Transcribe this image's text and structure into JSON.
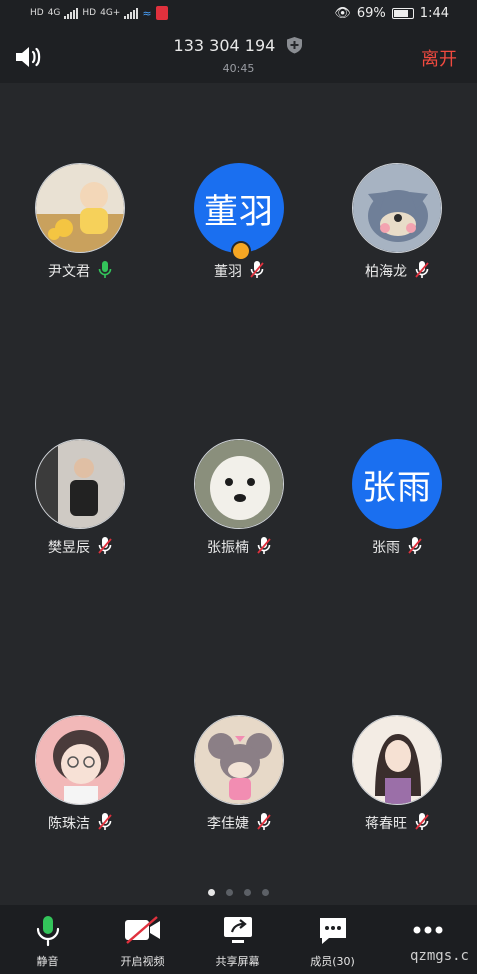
{
  "status_bar": {
    "network_labels": [
      "HD",
      "4G",
      "HD",
      "4G+"
    ],
    "battery_percent": "69%",
    "battery_level": 0.69,
    "time": "1:44"
  },
  "header": {
    "meeting_id": "133 304 194",
    "duration": "40:45",
    "leave_label": "离开"
  },
  "participants": [
    {
      "name": "尹文君",
      "avatar_text": "",
      "mic": "on"
    },
    {
      "name": "董羽",
      "avatar_text": "董羽",
      "mic": "muted",
      "host": true
    },
    {
      "name": "柏海龙",
      "avatar_text": "",
      "mic": "muted"
    },
    {
      "name": "樊昱辰",
      "avatar_text": "",
      "mic": "muted"
    },
    {
      "name": "张振楠",
      "avatar_text": "",
      "mic": "muted"
    },
    {
      "name": "张雨",
      "avatar_text": "张雨",
      "mic": "muted"
    },
    {
      "name": "陈珠洁",
      "avatar_text": "",
      "mic": "muted"
    },
    {
      "name": "李佳婕",
      "avatar_text": "",
      "mic": "muted"
    },
    {
      "name": "蒋春旺",
      "avatar_text": "",
      "mic": "muted"
    }
  ],
  "pagination": {
    "pages": 4,
    "current": 1
  },
  "toolbar": {
    "mute_label": "静音",
    "video_label": "开启视频",
    "share_label": "共享屏幕",
    "members_label": "成员(30)",
    "more_label": ""
  },
  "watermark": "qzmgs.c",
  "colors": {
    "accent_blue": "#1a6ff0",
    "leave_red": "#f04a3f",
    "mic_green": "#33c45a",
    "mic_muted_red": "#e0313d"
  }
}
